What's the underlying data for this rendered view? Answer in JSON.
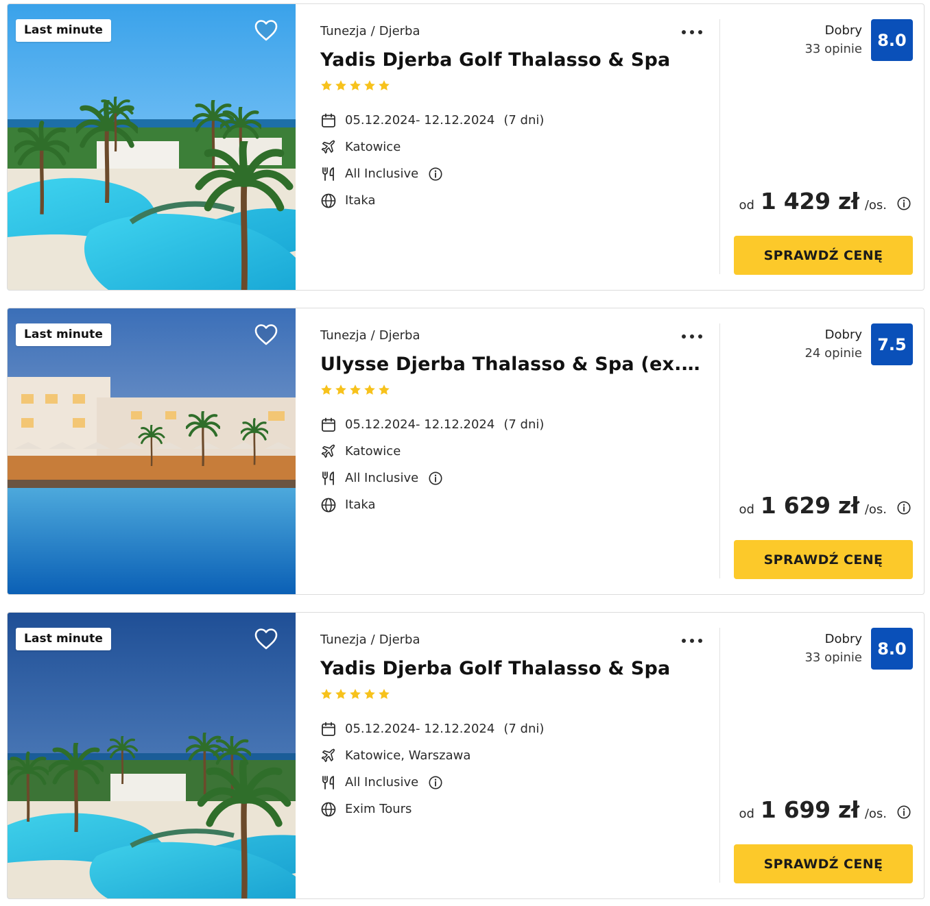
{
  "colors": {
    "accent_yellow": "#fcc92a",
    "score_blue": "#0a50b9",
    "star_yellow": "#f7c21c"
  },
  "offers": [
    {
      "badge": "Last minute",
      "breadcrumb": {
        "country": "Tunezja",
        "separator": "/",
        "region": "Djerba"
      },
      "title": "Yadis Djerba Golf Thalasso & Spa",
      "stars": 5,
      "dates": "05.12.2024- 12.12.2024",
      "duration": "(7 dni)",
      "departure": "Katowice",
      "board": "All Inclusive",
      "operator": "Itaka",
      "rating_word": "Dobry",
      "rating_count": "33 opinie",
      "score": "8.0",
      "price_prefix": "od",
      "price": "1 429 zł",
      "price_suffix": "/os.",
      "cta": "SPRAWDŹ CENĘ",
      "icons": [
        "heart-icon",
        "more-icon",
        "calendar-icon",
        "plane-icon",
        "utensils-icon",
        "info-icon",
        "globe-icon"
      ]
    },
    {
      "badge": "Last minute",
      "breadcrumb": {
        "country": "Tunezja",
        "separator": "/",
        "region": "Djerba"
      },
      "title": "Ulysse Djerba Thalasso & Spa (ex. Sen…",
      "stars": 5,
      "dates": "05.12.2024- 12.12.2024",
      "duration": "(7 dni)",
      "departure": "Katowice",
      "board": "All Inclusive",
      "operator": "Itaka",
      "rating_word": "Dobry",
      "rating_count": "24 opinie",
      "score": "7.5",
      "price_prefix": "od",
      "price": "1 629 zł",
      "price_suffix": "/os.",
      "cta": "SPRAWDŹ CENĘ",
      "icons": [
        "heart-icon",
        "more-icon",
        "calendar-icon",
        "plane-icon",
        "utensils-icon",
        "info-icon",
        "globe-icon"
      ]
    },
    {
      "badge": "Last minute",
      "breadcrumb": {
        "country": "Tunezja",
        "separator": "/",
        "region": "Djerba"
      },
      "title": "Yadis Djerba Golf Thalasso & Spa",
      "stars": 5,
      "dates": "05.12.2024- 12.12.2024",
      "duration": "(7 dni)",
      "departure": "Katowice, Warszawa",
      "board": "All Inclusive",
      "operator": "Exim Tours",
      "rating_word": "Dobry",
      "rating_count": "33 opinie",
      "score": "8.0",
      "price_prefix": "od",
      "price": "1 699 zł",
      "price_suffix": "/os.",
      "cta": "SPRAWDŹ CENĘ",
      "icons": [
        "heart-icon",
        "more-icon",
        "calendar-icon",
        "plane-icon",
        "utensils-icon",
        "info-icon",
        "globe-icon"
      ]
    }
  ]
}
